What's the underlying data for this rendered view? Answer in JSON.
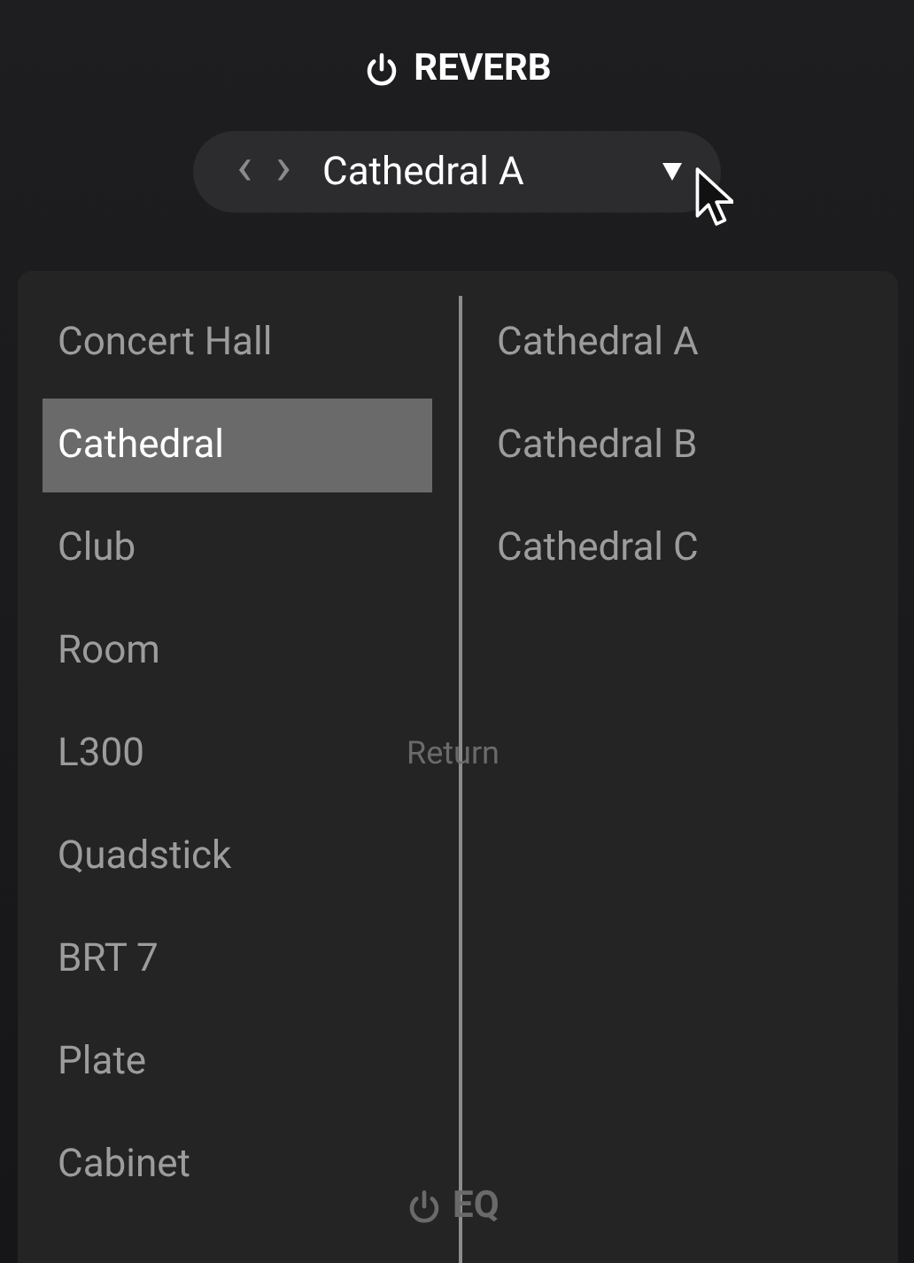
{
  "header": {
    "title": "REVERB",
    "power_on": true
  },
  "preset_selector": {
    "value": "Cathedral A",
    "prev": "‹",
    "next": "›"
  },
  "categories": [
    {
      "label": "Concert Hall",
      "selected": false
    },
    {
      "label": "Cathedral",
      "selected": true
    },
    {
      "label": "Club",
      "selected": false
    },
    {
      "label": "Room",
      "selected": false
    },
    {
      "label": "L300",
      "selected": false
    },
    {
      "label": "Quadstick",
      "selected": false
    },
    {
      "label": "BRT 7",
      "selected": false
    },
    {
      "label": "Plate",
      "selected": false
    },
    {
      "label": "Cabinet",
      "selected": false
    }
  ],
  "presets": [
    {
      "label": "Cathedral A",
      "selected": false
    },
    {
      "label": "Cathedral B",
      "selected": false
    },
    {
      "label": "Cathedral C",
      "selected": false
    }
  ],
  "background": {
    "return_label": "Return",
    "eq_label": "EQ"
  }
}
